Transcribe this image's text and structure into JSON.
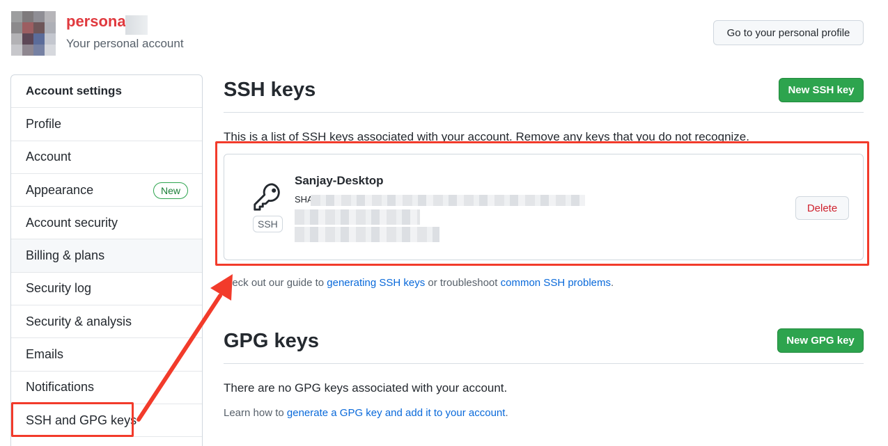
{
  "header": {
    "account_name": "personal",
    "account_subtitle": "Your personal account",
    "profile_button": "Go to your personal profile"
  },
  "sidebar": {
    "items": [
      {
        "label": "Account settings"
      },
      {
        "label": "Profile"
      },
      {
        "label": "Account"
      },
      {
        "label": "Appearance",
        "badge": "New"
      },
      {
        "label": "Account security"
      },
      {
        "label": "Billing & plans"
      },
      {
        "label": "Security log"
      },
      {
        "label": "Security & analysis"
      },
      {
        "label": "Emails"
      },
      {
        "label": "Notifications"
      },
      {
        "label": "SSH and GPG keys"
      }
    ]
  },
  "ssh": {
    "title": "SSH keys",
    "new_button": "New SSH key",
    "description": "This is a list of SSH keys associated with your account. Remove any keys that you do not recognize.",
    "key": {
      "icon": "key-icon",
      "type_badge": "SSH",
      "title": "Sanjay-Desktop",
      "fingerprint_prefix": "SHA",
      "delete_button": "Delete"
    },
    "guide_prefix": "heck out our guide to",
    "guide_link1": "generating SSH keys",
    "guide_middle": "or troubleshoot",
    "guide_link2": "common SSH problems",
    "guide_suffix": "."
  },
  "gpg": {
    "title": "GPG keys",
    "new_button": "New GPG key",
    "empty_text": "There are no GPG keys associated with your account.",
    "learn_prefix": "Learn how to",
    "learn_link": "generate a GPG key and add it to your account",
    "learn_suffix": "."
  },
  "colors": {
    "accent_green": "#2da44e",
    "link_blue": "#0969da",
    "danger_red": "#cf222e",
    "annotation_red": "#f23b2b"
  }
}
